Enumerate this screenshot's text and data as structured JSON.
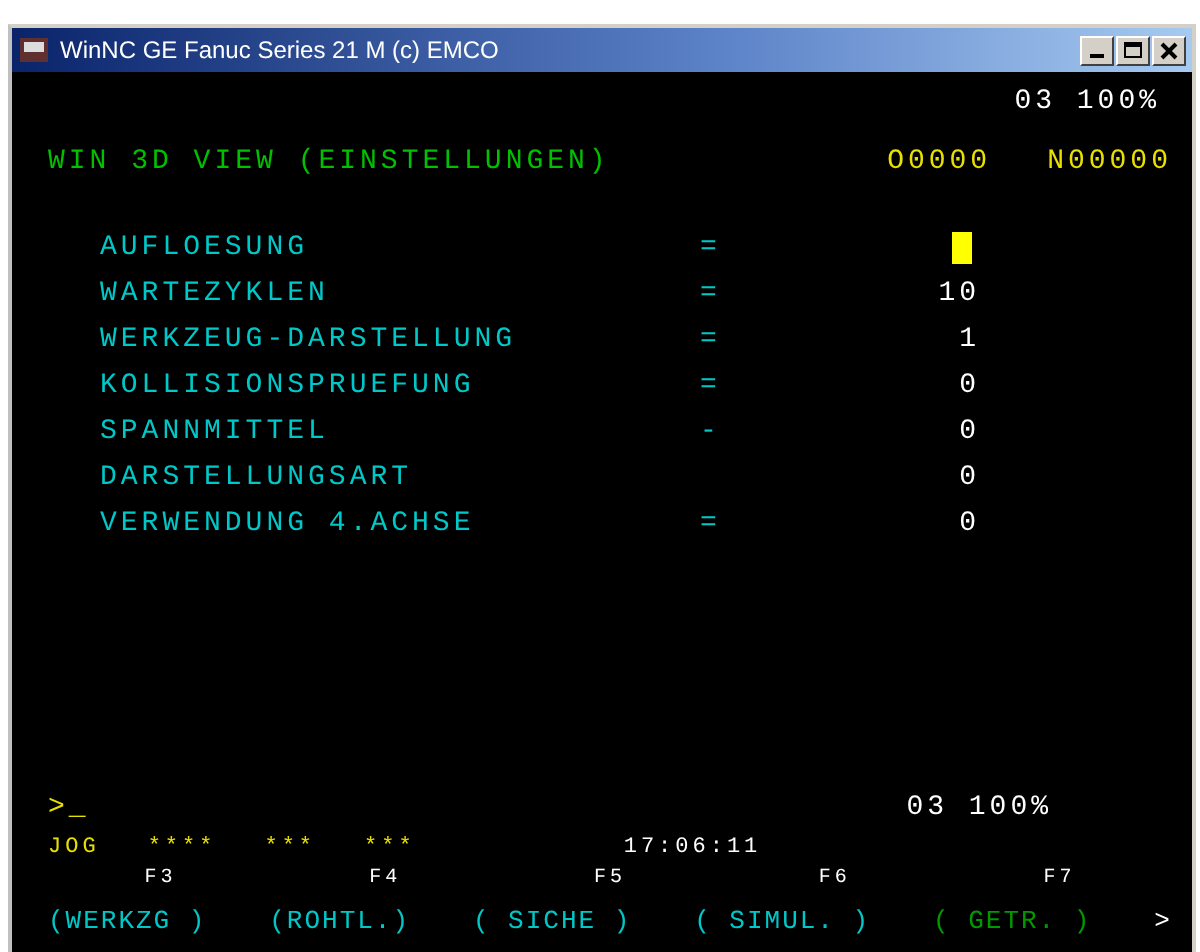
{
  "window": {
    "title": "WinNC GE Fanuc Series 21 M (c) EMCO"
  },
  "status_top": "03 100%",
  "header": {
    "title": "WIN 3D VIEW (EINSTELLUNGEN)",
    "program": "O0000",
    "block": "N00000"
  },
  "settings": [
    {
      "label": "AUFLOESUNG",
      "sign": "=",
      "selected": true
    },
    {
      "label": "WARTEZYKLEN",
      "sign": "=",
      "value": "10",
      "selected": false
    },
    {
      "label": "WERKZEUG-DARSTELLUNG",
      "sign": "=",
      "value": "1",
      "selected": false
    },
    {
      "label": "KOLLISIONSPRUEFUNG",
      "sign": "=",
      "value": "0",
      "selected": false
    },
    {
      "label": "SPANNMITTEL",
      "sign": "-",
      "value": "0",
      "selected": false
    },
    {
      "label": "DARSTELLUNGSART",
      "value": "0",
      "selected": false
    },
    {
      "label": "VERWENDUNG 4.ACHSE",
      "sign": "=",
      "value": "0",
      "selected": false
    }
  ],
  "prompt": {
    "text": ">_",
    "override": "03 100%"
  },
  "mode_line": {
    "mode": "JOG",
    "fields": [
      "****",
      "***",
      "***"
    ],
    "time": "17:06:11"
  },
  "softkeys": [
    {
      "key": "F3",
      "label": "(WERKZG )",
      "color": "#00c8c8"
    },
    {
      "key": "F4",
      "label": "(ROHTL.)",
      "color": "#00c8c8"
    },
    {
      "key": "F5",
      "label": "( SICHE )",
      "color": "#00c8c8"
    },
    {
      "key": "F6",
      "label": "( SIMUL. )",
      "color": "#00c8c8"
    },
    {
      "key": "F7",
      "label": "( GETR. )",
      "color": "#009900"
    }
  ],
  "more_label": ">"
}
